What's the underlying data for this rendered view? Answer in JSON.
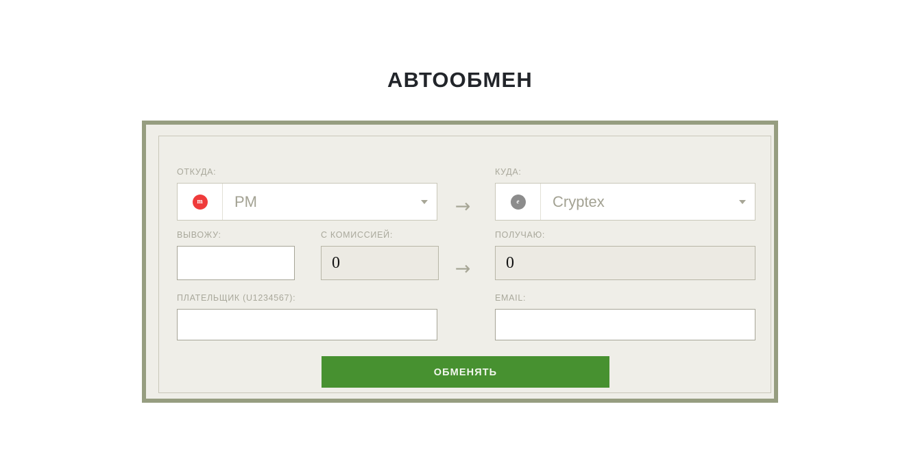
{
  "page": {
    "title": "АВТООБМЕН"
  },
  "form": {
    "from": {
      "label": "ОТКУДА:",
      "selected": "PM",
      "icon": "perfect-money-coin-icon",
      "icon_glyph": "m",
      "icon_color": "#ef3b3b",
      "caret": "chevron-down-icon"
    },
    "to": {
      "label": "КУДА:",
      "selected": "Cryptex",
      "icon": "cryptex-coin-icon",
      "icon_glyph": "e",
      "icon_color": "#8c8c8c",
      "caret": "chevron-down-icon"
    },
    "give": {
      "label": "ВЫВОЖУ:",
      "value": "",
      "placeholder": ""
    },
    "with_fee": {
      "label": "С КОМИССИЕЙ:",
      "value": "0"
    },
    "receive": {
      "label": "ПОЛУЧАЮ:",
      "value": "0"
    },
    "payer": {
      "label": "ПЛАТЕЛЬЩИК (U1234567):",
      "value": "",
      "placeholder": ""
    },
    "email": {
      "label": "EMAIL:",
      "value": "",
      "placeholder": ""
    },
    "arrows": {
      "glyph": "→",
      "name": "arrow-right-icon"
    },
    "submit": {
      "label": "ОБМЕНЯТЬ",
      "color": "#479130"
    }
  },
  "colors": {
    "page_background": "#ffffff",
    "panel_background": "#efeee8",
    "frame_border": "#969d80",
    "inner_border": "#c9c7b9",
    "label_text": "#a9a89b",
    "select_value_text": "#a3a293",
    "title_text": "#22252a",
    "accent_green": "#479130"
  }
}
